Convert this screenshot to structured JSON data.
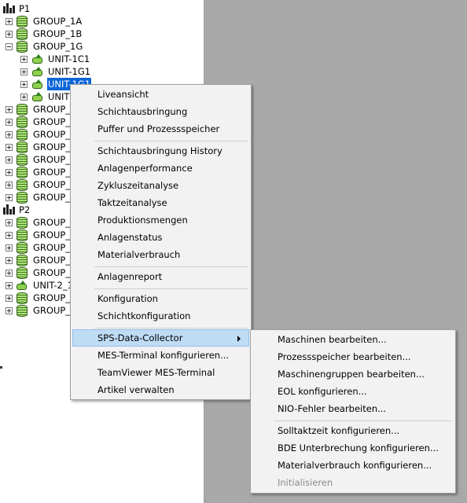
{
  "tree": {
    "plant1": "P1",
    "group_1a": "GROUP_1A",
    "group_1b": "GROUP_1B",
    "group_1g": "GROUP_1G",
    "unit_1c1": "UNIT-1C1",
    "unit_1g1": "UNIT-1G1",
    "unit_sel": "UNIT-1G1",
    "unit_4": "UNIT",
    "groups_p1": [
      "GROUP_",
      "GROUP_",
      "GROUP_",
      "GROUP_",
      "GROUP_",
      "GROUP_",
      "GROUP_",
      "GROUP_"
    ],
    "plant2": "P2",
    "groups_p2a": [
      "GROUP_",
      "GROUP_",
      "GROUP_",
      "GROUP_",
      "GROUP_"
    ],
    "unit_2": "UNIT-2_1",
    "groups_p2b": [
      "GROUP_",
      "GROUP_"
    ]
  },
  "context_menu": {
    "liveansicht": "Liveansicht",
    "schichtausbringung": "Schichtausbringung",
    "puffer": "Puffer und Prozessspeicher",
    "schicht_history": "Schichtausbringung History",
    "anlagenperformance": "Anlagenperformance",
    "zykluszeit": "Zykluszeitanalyse",
    "taktzeit": "Taktzeitanalyse",
    "produktionsmengen": "Produktionsmengen",
    "anlagenstatus": "Anlagenstatus",
    "materialverbrauch": "Materialverbrauch",
    "anlagenreport": "Anlagenreport",
    "konfiguration": "Konfiguration",
    "schichtkonfiguration": "Schichtkonfiguration",
    "sps_collector": "SPS-Data-Collector",
    "mes_terminal": "MES-Terminal konfigurieren...",
    "teamviewer": "TeamViewer MES-Terminal",
    "artikel": "Artikel verwalten"
  },
  "submenu": {
    "maschinen": "Maschinen bearbeiten...",
    "prozessspeicher": "Prozessspeicher bearbeiten...",
    "maschinengruppen": "Maschinengruppen bearbeiten...",
    "eol": "EOL konfigurieren...",
    "nio": "NIO-Fehler bearbeiten...",
    "solltaktzeit": "Solltaktzeit konfigurieren...",
    "bde": "BDE Unterbrechung konfigurieren...",
    "materialverbrauch": "Materialverbrauch konfigurieren...",
    "initialisieren": "Initialisieren"
  },
  "colors": {
    "selection": "#0a64d8",
    "menu_highlight": "#bfdcf5",
    "pane_gray": "#a9a9a9"
  }
}
